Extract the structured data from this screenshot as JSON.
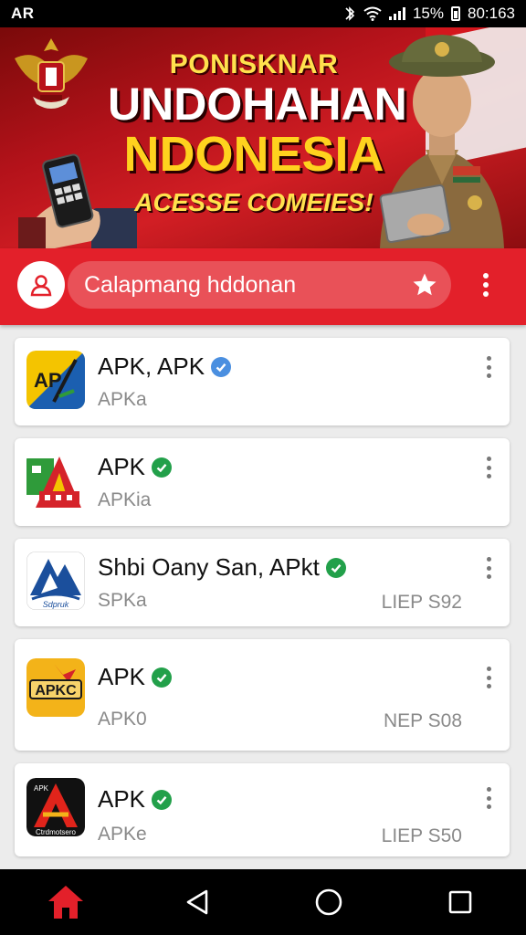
{
  "status_bar": {
    "left": "AR",
    "battery_text": "15%",
    "time": "80:163",
    "icons": [
      "signal-icon",
      "wifi-icon",
      "cellular-icon",
      "battery-icon"
    ]
  },
  "banner": {
    "subtitle": "PONISKNAR",
    "title_line1": "UNDOHAHAN",
    "title_line2": "NDONESIA",
    "cta": "ACESSE COMEIES!"
  },
  "app_bar": {
    "search_text": "Calapmang hddonan",
    "icons": [
      "user-icon",
      "star-icon",
      "more-vert-icon"
    ],
    "accent": "#e3202a"
  },
  "apps": [
    {
      "title": "APK, APK",
      "subtitle": "APKa",
      "meta": "",
      "badge_color": "#4a8fe0",
      "icon": "apk-logo-yellow-blue"
    },
    {
      "title": "APK",
      "subtitle": "APKia",
      "meta": "",
      "badge_color": "#22a04a",
      "icon": "apk-logo-green-red-house"
    },
    {
      "title": "Shbi Oany San, APkt",
      "subtitle": "SPKa",
      "meta": "LIEP S92",
      "badge_color": "#22a04a",
      "icon": "apk-logo-blue-mountain"
    },
    {
      "title": "APK",
      "subtitle": "APK0",
      "meta": "NEP S08",
      "badge_color": "#22a04a",
      "icon": "apk-logo-gold-star"
    },
    {
      "title": "APK",
      "subtitle": "APKe",
      "meta": "LIEP S50",
      "badge_color": "#22a04a",
      "icon": "apk-logo-black-red-a"
    }
  ],
  "nav_bar": {
    "icons": [
      "home-icon",
      "back-icon",
      "home-circle-icon",
      "recents-icon"
    ],
    "home_color": "#e3202a"
  },
  "icon_labels": {
    "app3": "Sdpruk",
    "app4": "APKC",
    "app5_top": "APK",
    "app5_bottom": "Ctrdmotsero"
  }
}
